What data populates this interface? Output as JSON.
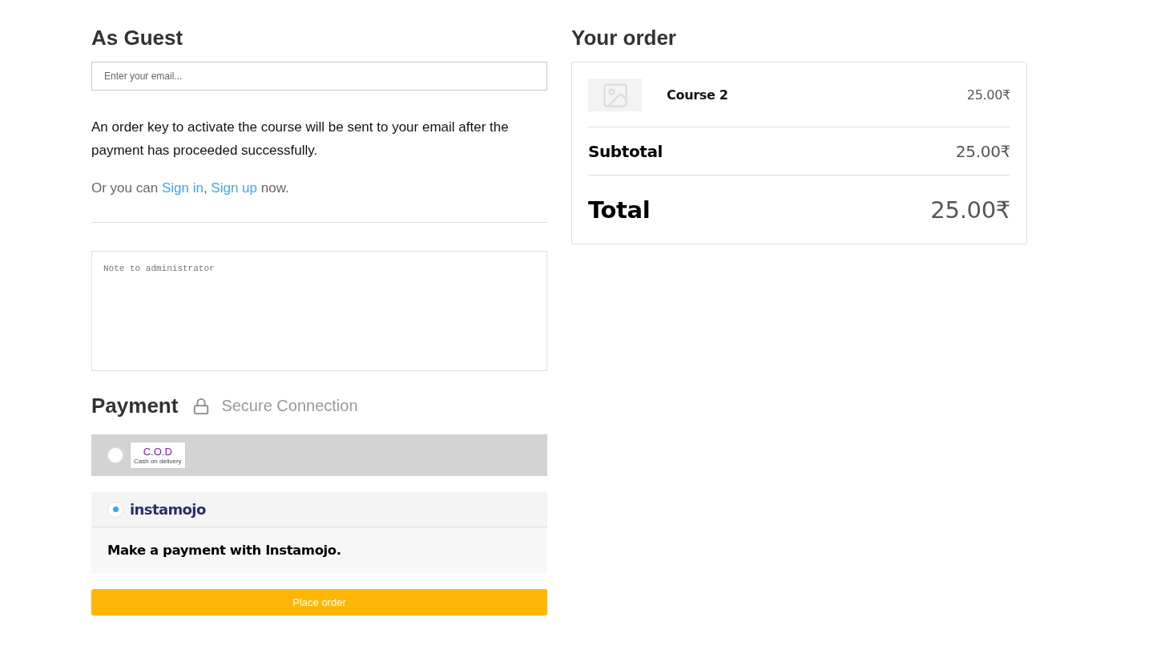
{
  "guest": {
    "title": "As Guest",
    "email": {
      "placeholder": "Enter your email..."
    },
    "info": "An order key to activate the course will be sent to your email after the payment has proceeded successfully.",
    "signin_note": {
      "prefix": "Or you can",
      "links": [
        {
          "label": "Sign in"
        },
        {
          "label": "Sign up"
        }
      ],
      "separator": ",",
      "suffix": "now."
    }
  },
  "note": {
    "placeholder": "Note to administrator"
  },
  "payment": {
    "title": "Payment",
    "secure_label": "Secure Connection",
    "methods": [
      {
        "kind": "cod",
        "selected": false,
        "logo_title": "C.O.D",
        "logo_subtitle": "Cash on delivery"
      },
      {
        "kind": "instamojo",
        "selected": true,
        "logo_text": "instamojo",
        "description": "Make a payment with Instamojo."
      }
    ],
    "submit": "Place order"
  },
  "order": {
    "title": "Your order",
    "items": [
      {
        "name": "Course 2",
        "price": "25.00₹"
      }
    ],
    "subtotal": {
      "label": "Subtotal",
      "value": "25.00₹"
    },
    "total": {
      "label": "Total",
      "value": "25.00₹"
    }
  }
}
